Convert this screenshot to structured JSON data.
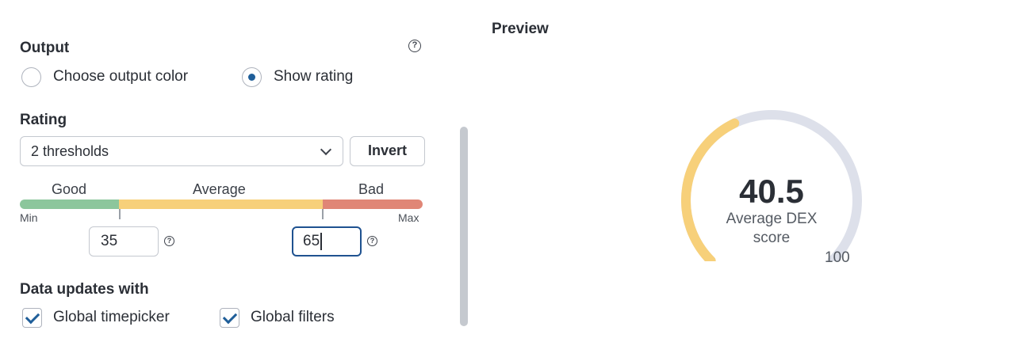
{
  "output": {
    "title": "Output",
    "options": [
      {
        "label": "Choose output color",
        "checked": false
      },
      {
        "label": "Show rating",
        "checked": true
      }
    ]
  },
  "rating": {
    "title": "Rating",
    "select_value": "2 thresholds",
    "invert_label": "Invert",
    "bands": [
      "Good",
      "Average",
      "Bad"
    ],
    "min_label": "Min",
    "max_label": "Max",
    "threshold_1": "35",
    "threshold_2": "65",
    "colors": {
      "good": "#8cc69c",
      "average": "#f7d07a",
      "bad": "#e08676"
    }
  },
  "data_updates": {
    "title": "Data updates with",
    "options": [
      {
        "label": "Global timepicker",
        "checked": true
      },
      {
        "label": "Global filters",
        "checked": true
      }
    ]
  },
  "preview": {
    "title": "Preview",
    "value": "40.5",
    "label_line1": "Average DEX",
    "label_line2": "score",
    "max_text": "100",
    "gauge": {
      "value": 40.5,
      "min": 0,
      "max": 100,
      "fill_color": "#f7d07a",
      "track_color": "#dde0ea"
    }
  }
}
